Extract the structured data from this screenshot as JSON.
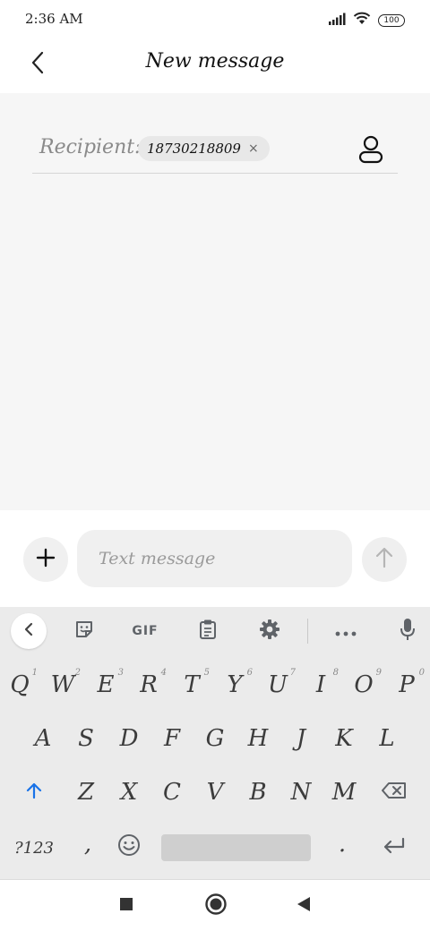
{
  "status_bar": {
    "time": "2:36 AM",
    "battery": "100",
    "icons": [
      "signal-icon",
      "wifi-icon",
      "battery-icon"
    ]
  },
  "header": {
    "title": "New message",
    "back_icon": "back-chevron-icon"
  },
  "recipient": {
    "label": "Recipient:",
    "chip_value": "18730218809",
    "chip_close": "×",
    "contact_icon": "person-icon"
  },
  "composer": {
    "placeholder": "Text message",
    "add_icon": "plus-icon",
    "send_icon": "arrow-up-icon"
  },
  "keyboard": {
    "toolbar": {
      "gif_label": "GIF",
      "icons": [
        "chevron-left-icon",
        "sticker-icon",
        "gif-icon",
        "clipboard-icon",
        "settings-icon",
        "more-icon",
        "microphone-icon"
      ]
    },
    "row1": [
      {
        "key": "Q",
        "hint": "1"
      },
      {
        "key": "W",
        "hint": "2"
      },
      {
        "key": "E",
        "hint": "3"
      },
      {
        "key": "R",
        "hint": "4"
      },
      {
        "key": "T",
        "hint": "5"
      },
      {
        "key": "Y",
        "hint": "6"
      },
      {
        "key": "U",
        "hint": "7"
      },
      {
        "key": "I",
        "hint": "8"
      },
      {
        "key": "O",
        "hint": "9"
      },
      {
        "key": "P",
        "hint": "0"
      }
    ],
    "row2": [
      "A",
      "S",
      "D",
      "F",
      "G",
      "H",
      "J",
      "K",
      "L"
    ],
    "row3": [
      "Z",
      "X",
      "C",
      "V",
      "B",
      "N",
      "M"
    ],
    "symbols_label": "?123",
    "comma": ",",
    "period": ".",
    "accent_color": "#1a73e8"
  },
  "nav_bar": {
    "icons": [
      "recents-square-icon",
      "home-circle-icon",
      "back-triangle-icon"
    ]
  }
}
